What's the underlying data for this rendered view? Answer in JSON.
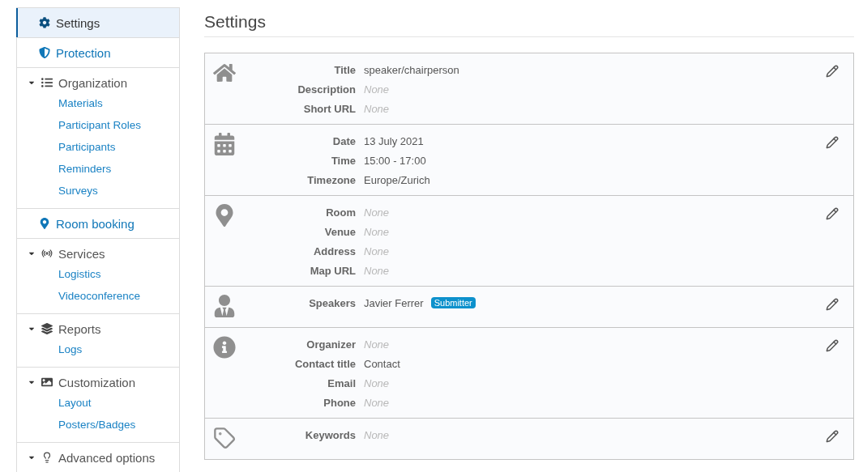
{
  "sidebar": {
    "items": [
      {
        "label": "Settings",
        "selected": true
      },
      {
        "label": "Protection",
        "selected": false
      },
      {
        "label": "Organization",
        "selected": false,
        "expanded": true,
        "children": [
          {
            "label": "Materials",
            "selected": false
          },
          {
            "label": "Participant Roles",
            "selected": false
          },
          {
            "label": "Participants",
            "selected": false
          },
          {
            "label": "Reminders",
            "selected": false
          },
          {
            "label": "Surveys",
            "selected": false
          }
        ]
      },
      {
        "label": "Room booking",
        "selected": false
      },
      {
        "label": "Services",
        "selected": false,
        "expanded": true,
        "children": [
          {
            "label": "Logistics",
            "selected": false
          },
          {
            "label": "Videoconference",
            "selected": false
          }
        ]
      },
      {
        "label": "Reports",
        "selected": false,
        "expanded": true,
        "children": [
          {
            "label": "Logs",
            "selected": false
          }
        ]
      },
      {
        "label": "Customization",
        "selected": false,
        "expanded": true,
        "children": [
          {
            "label": "Layout",
            "selected": false
          },
          {
            "label": "Posters/Badges",
            "selected": false
          }
        ]
      },
      {
        "label": "Advanced options",
        "selected": false,
        "expanded": true
      }
    ]
  },
  "page": {
    "title": "Settings"
  },
  "sections": [
    {
      "rows": [
        {
          "label": "Title",
          "value": "speaker/chairperson",
          "empty": false
        },
        {
          "label": "Description",
          "value": "None",
          "empty": true
        },
        {
          "label": "Short URL",
          "value": "None",
          "empty": true
        }
      ]
    },
    {
      "rows": [
        {
          "label": "Date",
          "value": "13 July 2021",
          "empty": false
        },
        {
          "label": "Time",
          "value": "15:00 - 17:00",
          "empty": false
        },
        {
          "label": "Timezone",
          "value": "Europe/Zurich",
          "empty": false
        }
      ]
    },
    {
      "rows": [
        {
          "label": "Room",
          "value": "None",
          "empty": true
        },
        {
          "label": "Venue",
          "value": "None",
          "empty": true
        },
        {
          "label": "Address",
          "value": "None",
          "empty": true
        },
        {
          "label": "Map URL",
          "value": "None",
          "empty": true
        }
      ]
    },
    {
      "rows": [
        {
          "label": "Speakers",
          "value": "Javier Ferrer",
          "empty": false,
          "badge": "Submitter"
        }
      ]
    },
    {
      "rows": [
        {
          "label": "Organizer",
          "value": "None",
          "empty": true
        },
        {
          "label": "Contact title",
          "value": "Contact",
          "empty": false
        },
        {
          "label": "Email",
          "value": "None",
          "empty": true
        },
        {
          "label": "Phone",
          "value": "None",
          "empty": true
        }
      ]
    },
    {
      "rows": [
        {
          "label": "Keywords",
          "value": "None",
          "empty": true
        }
      ]
    }
  ]
}
